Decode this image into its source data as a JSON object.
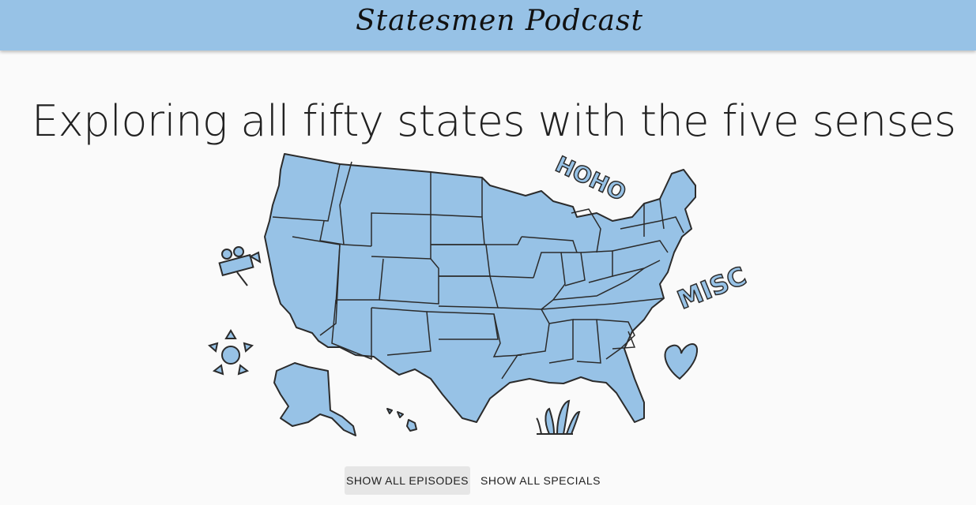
{
  "header": {
    "brand": "Statesmen Podcast",
    "accent_color": "#97c2e6"
  },
  "main": {
    "headline": "Exploring all fifty states with the five senses",
    "map": {
      "fill_color": "#97c2e6",
      "stroke_color": "#2b2b2b",
      "extras": {
        "hoho_label": "HOHO",
        "misc_label": "MISC",
        "icons": [
          "camera-icon",
          "sun-icon",
          "heart-icon",
          "grass-icon"
        ]
      }
    }
  },
  "actions": {
    "episodes_label": "SHOW ALL EPISODES",
    "specials_label": "SHOW ALL SPECIALS"
  }
}
